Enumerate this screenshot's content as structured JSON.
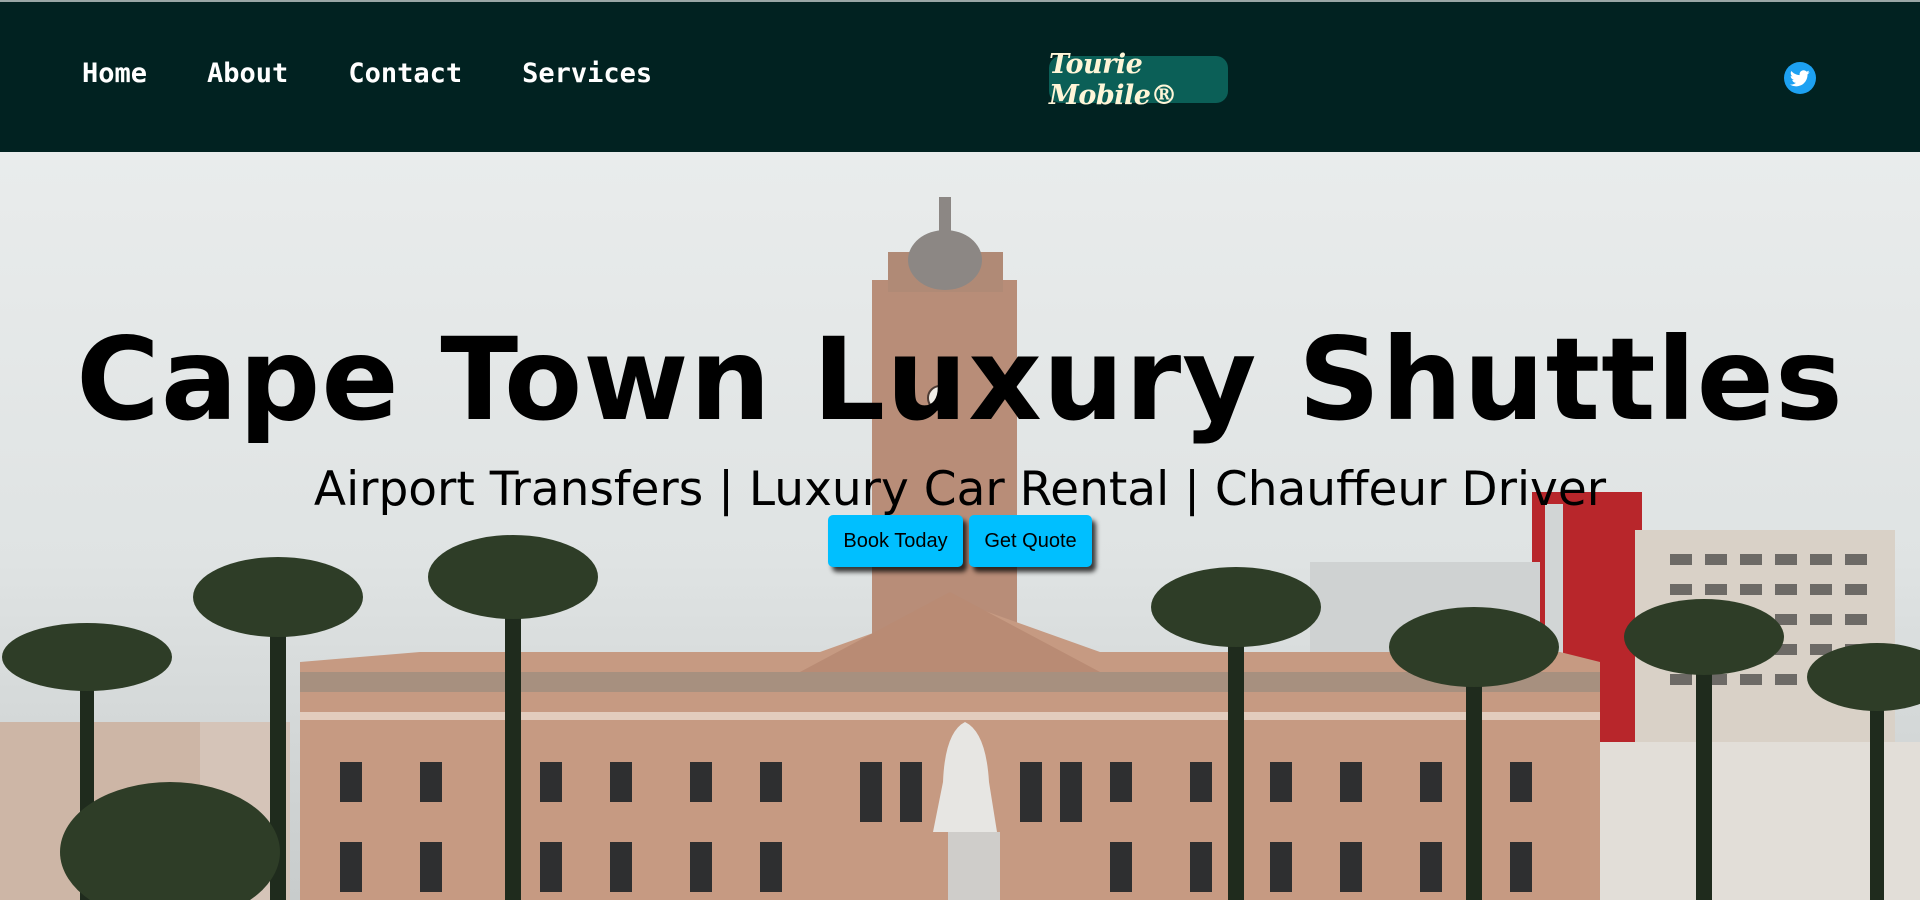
{
  "nav": {
    "links": [
      {
        "label": "Home"
      },
      {
        "label": "About"
      },
      {
        "label": "Contact"
      },
      {
        "label": "Services"
      }
    ],
    "logo_text": "Tourie Mobile®",
    "social_icon": "twitter-icon"
  },
  "hero": {
    "title": "Cape Town Luxury Shuttles",
    "subtitle": "Airport Transfers | Luxury Car Rental | Chauffeur Driver",
    "buttons": {
      "book_label": "Book Today",
      "quote_label": "Get Quote"
    },
    "background_image": "cape-town-city-hall-photo"
  },
  "colors": {
    "navbar_bg": "#012221",
    "logo_bg": "#0b5f57",
    "cta_bg": "#00bfff",
    "twitter_blue": "#1da1f2"
  }
}
